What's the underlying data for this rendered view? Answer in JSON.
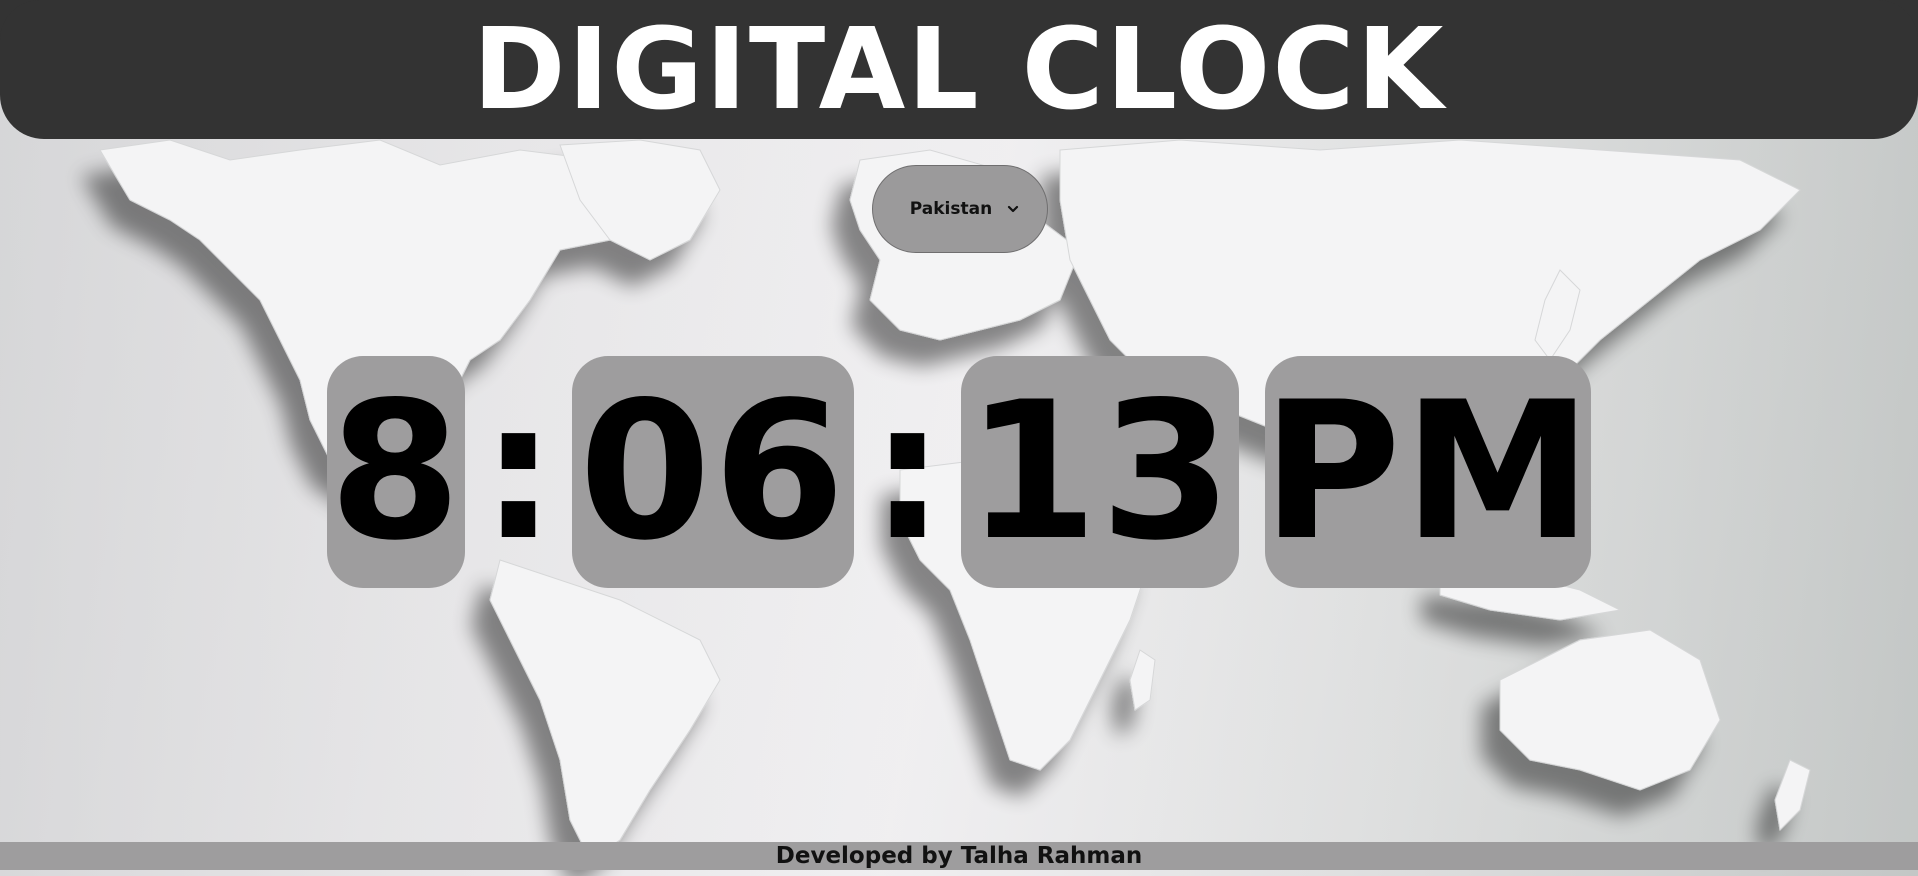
{
  "header": {
    "title": "DIGITAL CLOCK"
  },
  "country_select": {
    "selected": "Pakistan",
    "icon": "chevron-down-icon"
  },
  "clock": {
    "hours": "8",
    "minutes": "06",
    "seconds": "13",
    "period": "PM",
    "separator": ":"
  },
  "footer": {
    "credit": "Developed by Talha Rahman"
  },
  "colors": {
    "header_bg": "#333333",
    "segment_bg": "#9e9d9e",
    "footer_bg": "#9e9d9e",
    "map_land": "#f5f5f6",
    "map_shadow": "#9aa19f"
  }
}
